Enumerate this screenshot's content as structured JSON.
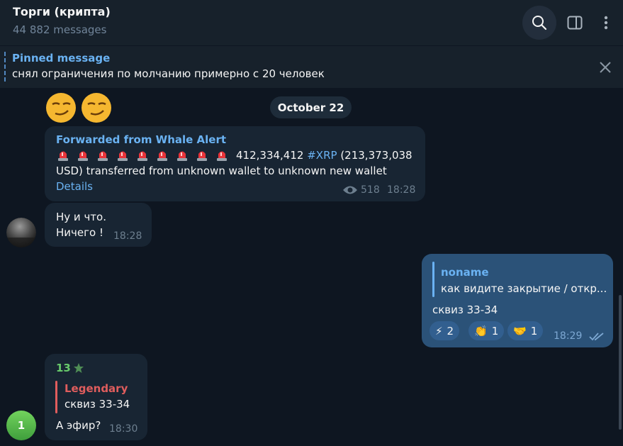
{
  "header": {
    "title": "Торги (крипта)",
    "subtitle": "44 882 messages",
    "icons": [
      "search-icon",
      "sidebar-toggle-icon",
      "more-vertical-icon"
    ]
  },
  "pinned": {
    "title": "Pinned message",
    "text": "снял ограничения по молчанию примерно с 20 человек"
  },
  "date_separator": "October 22",
  "messages": [
    {
      "forwarded_from": "Forwarded from Whale Alert",
      "alert_emoji_count": 9,
      "line1_amount": "412,334,412",
      "line1_hashtag": "#XRP",
      "line1_rest": "(213,373,038",
      "line2": "USD) transferred from unknown wallet to unknown new wallet",
      "link": "Details",
      "views": "518",
      "time": "18:28"
    },
    {
      "line1": "Ну и что.",
      "line2": "Ничего !",
      "time": "18:28"
    },
    {
      "reply_author": "noname",
      "reply_text": "как видите закрытие / откр...",
      "text": "сквиз 33-34",
      "reactions": [
        {
          "emoji": "⚡",
          "count": "2"
        },
        {
          "emoji": "👏",
          "count": "1"
        },
        {
          "emoji": "🤝",
          "count": "1"
        }
      ],
      "time": "18:29"
    },
    {
      "sender": "13",
      "reply_author": "Legendary",
      "reply_text": "сквиз 33-34",
      "text": "А эфир?",
      "time": "18:30",
      "avatar_letter": "1"
    }
  ],
  "colors": {
    "background": "#0e1621",
    "header": "#17212b",
    "incoming_bubble": "#182533",
    "outgoing_bubble": "#2b5278",
    "accent": "#6ab2f2",
    "reply_red": "#e05d5d",
    "sender_green": "#68c96b"
  }
}
